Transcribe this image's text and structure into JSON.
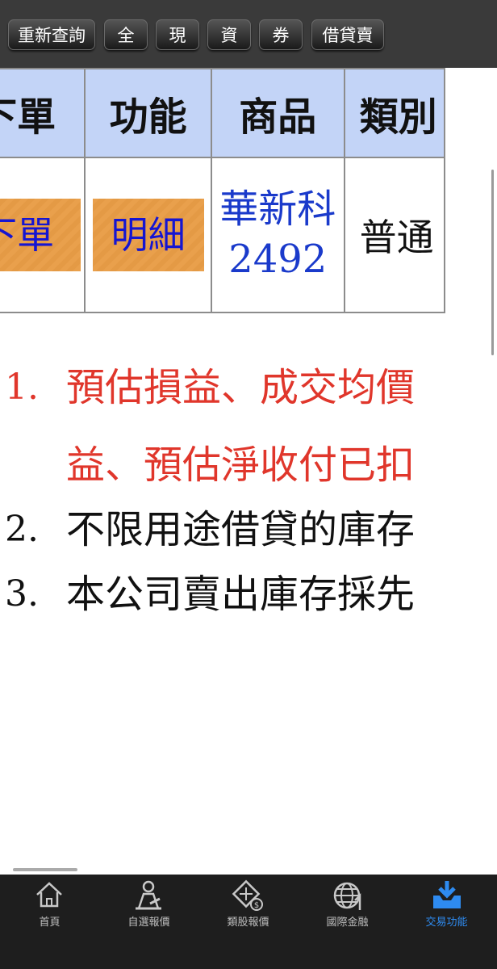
{
  "toolbar": {
    "buttons": [
      "重新查詢",
      "全",
      "現",
      "資",
      "券",
      "借貸賣"
    ]
  },
  "table": {
    "headers": [
      "下單",
      "功能",
      "商品",
      "類別"
    ],
    "row": {
      "order_button": "下單",
      "detail_button": "明細",
      "product_name": "華新科",
      "product_code": "2492",
      "category": "普通"
    }
  },
  "notes": [
    {
      "num": "1.",
      "text": "預估損益、成交均價",
      "color": "#e0362b"
    },
    {
      "num": "",
      "text": "益、預估淨收付已扣",
      "color": "#e0362b"
    },
    {
      "num": "2.",
      "text": "不限用途借貸的庫存",
      "color": "#111111"
    },
    {
      "num": "3.",
      "text": "本公司賣出庫存採先",
      "color": "#111111"
    }
  ],
  "tabbar": {
    "items": [
      {
        "label": "首頁",
        "icon": "home-icon"
      },
      {
        "label": "自選報價",
        "icon": "watchlist-icon"
      },
      {
        "label": "類股報價",
        "icon": "sector-quote-icon"
      },
      {
        "label": "國際金融",
        "icon": "globe-icon"
      },
      {
        "label": "交易功能",
        "icon": "trade-download-icon"
      }
    ],
    "active_index": 4,
    "active_color": "#2e8bf0"
  }
}
